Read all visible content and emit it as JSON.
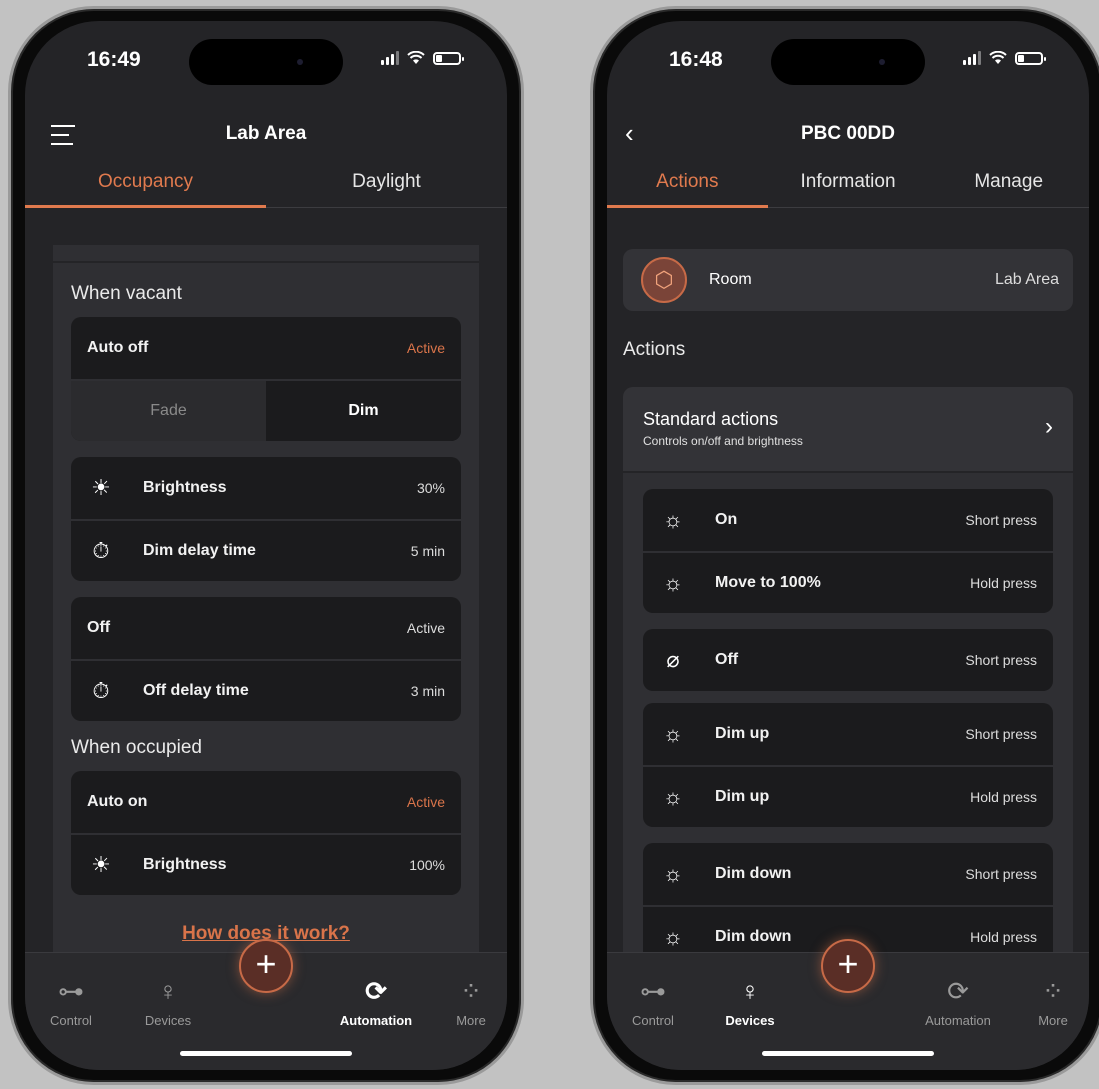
{
  "left": {
    "status_time": "16:49",
    "title": "Lab Area",
    "tabs": [
      "Occupancy",
      "Daylight"
    ],
    "when_vacant_label": "When vacant",
    "auto_off": {
      "label": "Auto off",
      "value": "Active"
    },
    "fade_label": "Fade",
    "dim_label": "Dim",
    "brightness": {
      "label": "Brightness",
      "value": "30%"
    },
    "dim_delay": {
      "label": "Dim delay time",
      "value": "5 min"
    },
    "off": {
      "label": "Off",
      "value": "Active"
    },
    "off_delay": {
      "label": "Off delay time",
      "value": "3 min"
    },
    "when_occupied_label": "When occupied",
    "auto_on": {
      "label": "Auto on",
      "value": "Active"
    },
    "occupied_brightness": {
      "label": "Brightness",
      "value": "100%"
    },
    "how_link": "How does it work?",
    "tabbar": [
      "Control",
      "Devices",
      "Automation",
      "More"
    ]
  },
  "right": {
    "status_time": "16:48",
    "title": "PBC 00DD",
    "tabs": [
      "Actions",
      "Information",
      "Manage"
    ],
    "room": {
      "label": "Room",
      "value": "Lab Area"
    },
    "actions_label": "Actions",
    "standard": {
      "title": "Standard actions",
      "subtitle": "Controls on/off and brightness"
    },
    "rows": [
      {
        "label": "On",
        "value": "Short press"
      },
      {
        "label": "Move to 100%",
        "value": "Hold press"
      },
      {
        "label": "Off",
        "value": "Short press"
      },
      {
        "label": "Dim up",
        "value": "Short press"
      },
      {
        "label": "Dim up",
        "value": "Hold press"
      },
      {
        "label": "Dim down",
        "value": "Short press"
      },
      {
        "label": "Dim down",
        "value": "Hold press"
      }
    ],
    "tabbar": [
      "Control",
      "Devices",
      "Automation",
      "More"
    ]
  },
  "colors": {
    "accent": "#d9744a",
    "background": "#242427",
    "card": "#1b1b1d"
  },
  "icons": {
    "fab": "+",
    "chevron": "›",
    "back": "‹"
  }
}
